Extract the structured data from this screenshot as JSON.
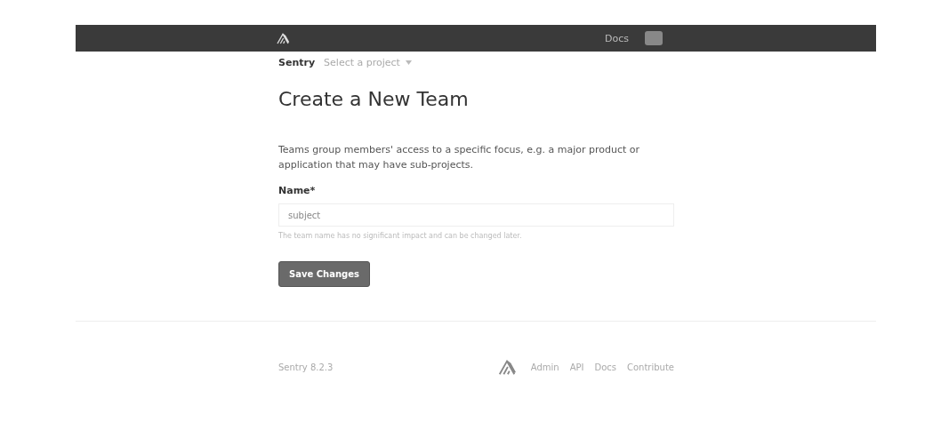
{
  "header": {
    "links": [
      {
        "label": "Docs"
      }
    ]
  },
  "breadcrumb": {
    "org": "Sentry",
    "project_placeholder": "Select a project"
  },
  "title": "Create a New Team",
  "description": "Teams group members' access to a specific focus, e.g. a major product or application that may have sub-projects.",
  "form": {
    "label": "Name*",
    "value": "subject",
    "help": "The team name has no significant impact and can be changed later.",
    "submit": "Save Changes"
  },
  "footer": {
    "version": "Sentry 8.2.3",
    "links": [
      {
        "label": "Admin"
      },
      {
        "label": "API"
      },
      {
        "label": "Docs"
      },
      {
        "label": "Contribute"
      }
    ]
  }
}
